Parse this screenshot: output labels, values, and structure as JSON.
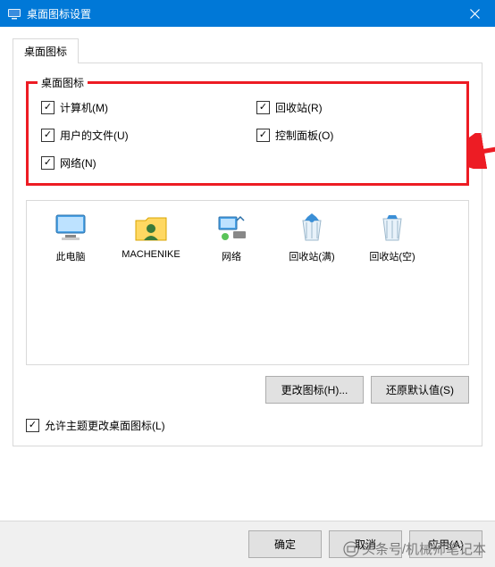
{
  "titlebar": {
    "title": "桌面图标设置"
  },
  "tab": {
    "label": "桌面图标"
  },
  "groupbox": {
    "title": "桌面图标",
    "items": [
      {
        "label": "计算机(M)"
      },
      {
        "label": "回收站(R)"
      },
      {
        "label": "用户的文件(U)"
      },
      {
        "label": "控制面板(O)"
      },
      {
        "label": "网络(N)"
      }
    ]
  },
  "icons": [
    {
      "label": "此电脑"
    },
    {
      "label": "MACHENIKE"
    },
    {
      "label": "网络"
    },
    {
      "label": "回收站(满)"
    },
    {
      "label": "回收站(空)"
    }
  ],
  "buttons": {
    "change_icon": "更改图标(H)...",
    "restore_default": "还原默认值(S)"
  },
  "allow_theme": {
    "label": "允许主题更改桌面图标(L)"
  },
  "footer": {
    "ok": "确定",
    "cancel": "取消",
    "apply": "应用(A)"
  },
  "watermark": "头条号/机械师笔记本"
}
